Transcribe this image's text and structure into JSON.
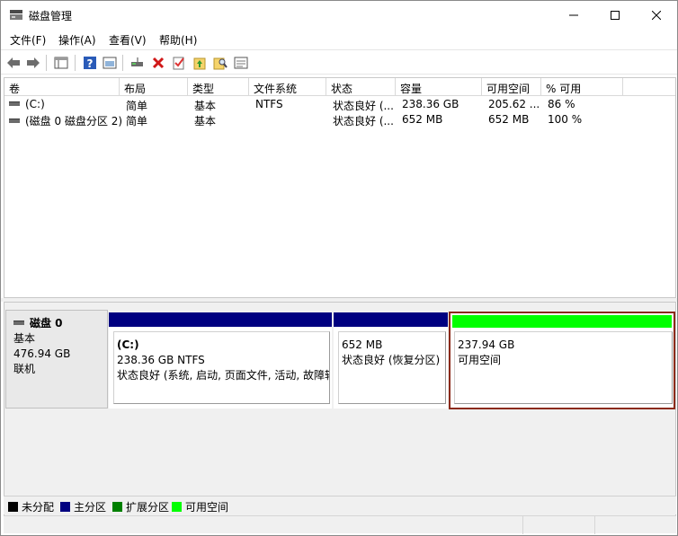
{
  "window": {
    "title": "磁盘管理",
    "buttons": [
      "minimize",
      "maximize",
      "close"
    ]
  },
  "menu": [
    {
      "label": "文件(F)"
    },
    {
      "label": "操作(A)"
    },
    {
      "label": "查看(V)"
    },
    {
      "label": "帮助(H)"
    }
  ],
  "toolbar": {
    "icons": [
      "back-arrow-icon",
      "forward-arrow-icon",
      "properties-grid-icon",
      "help-icon",
      "view-icon",
      "connect-disk-icon",
      "delete-icon",
      "check-icon",
      "folder-up-icon",
      "search-folder-icon",
      "settings-window-icon"
    ]
  },
  "volumes": {
    "columns": [
      "卷",
      "布局",
      "类型",
      "文件系统",
      "状态",
      "容量",
      "可用空间",
      "% 可用"
    ],
    "rows": [
      {
        "volume": "(C:)",
        "layout": "简单",
        "type": "基本",
        "fs": "NTFS",
        "status": "状态良好 (...",
        "capacity": "238.36 GB",
        "free": "205.62 ...",
        "pct": "86 %"
      },
      {
        "volume": "(磁盘 0 磁盘分区 2)",
        "layout": "简单",
        "type": "基本",
        "fs": "",
        "status": "状态良好 (...",
        "capacity": "652 MB",
        "free": "652 MB",
        "pct": "100 %"
      }
    ]
  },
  "disk": {
    "name": "磁盘 0",
    "type": "基本",
    "size": "476.94 GB",
    "status": "联机",
    "partitions": [
      {
        "title": "(C:)",
        "line1": "238.36 GB NTFS",
        "line2": "状态良好 (系统, 启动, 页面文件, 活动, 故障转",
        "color": "#000080"
      },
      {
        "title": "",
        "line1": "652 MB",
        "line2": "状态良好 (恢复分区)",
        "color": "#000080"
      },
      {
        "title": "",
        "line1": "237.94 GB",
        "line2": "可用空间",
        "color": "#00ff00"
      }
    ]
  },
  "legend": [
    {
      "label": "未分配",
      "color": "#000000"
    },
    {
      "label": "主分区",
      "color": "#000080"
    },
    {
      "label": "扩展分区",
      "color": "#008000"
    },
    {
      "label": "可用空间",
      "color": "#00ff00"
    }
  ]
}
